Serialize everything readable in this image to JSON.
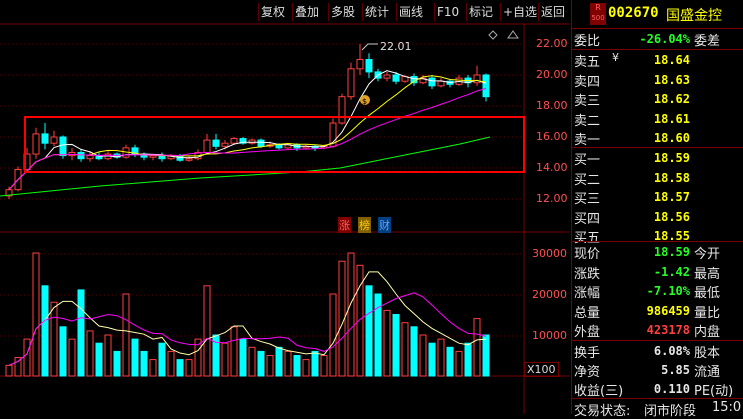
{
  "toolbar": {
    "buttons": [
      "复权",
      "叠加",
      "多股",
      "统计",
      "画线",
      "F10",
      "标记",
      "+自选",
      "返回"
    ]
  },
  "main_chart": {
    "y_ticks": [
      "22.01",
      "22.00",
      "20.00",
      "18.00",
      "16.00",
      "14.00",
      "12.00"
    ],
    "high_label": "22.01",
    "tags": [
      "涨",
      "榜",
      "财"
    ]
  },
  "volume_chart": {
    "y_ticks": [
      "30000",
      "20000",
      "10000"
    ],
    "unit": "X100"
  },
  "stock": {
    "r_badge": "R",
    "r_sub": "500",
    "code": "002670",
    "name": "国盛金控"
  },
  "weibi": {
    "label": "委比",
    "value": "-26.04%",
    "label2": "委差"
  },
  "asks": [
    {
      "label": "卖五",
      "mark": "¥",
      "price": "18.64"
    },
    {
      "label": "卖四",
      "mark": "",
      "price": "18.63"
    },
    {
      "label": "卖三",
      "mark": "",
      "price": "18.62"
    },
    {
      "label": "卖二",
      "mark": "",
      "price": "18.61"
    },
    {
      "label": "卖一",
      "mark": "",
      "price": "18.60"
    }
  ],
  "bids": [
    {
      "label": "买一",
      "price": "18.59"
    },
    {
      "label": "买二",
      "price": "18.58"
    },
    {
      "label": "买三",
      "price": "18.57"
    },
    {
      "label": "买四",
      "price": "18.56"
    },
    {
      "label": "买五",
      "price": "18.55"
    }
  ],
  "stats": [
    {
      "label": "现价",
      "value": "18.59",
      "label2": "今开",
      "color": "green"
    },
    {
      "label": "涨跌",
      "value": "-1.42",
      "label2": "最高",
      "color": "green"
    },
    {
      "label": "涨幅",
      "value": "-7.10%",
      "label2": "最低",
      "color": "green"
    },
    {
      "label": "总量",
      "value": "986459",
      "label2": "量比",
      "color": "yellow"
    },
    {
      "label": "外盘",
      "value": "423178",
      "label2": "内盘",
      "color": "red"
    }
  ],
  "stats2": [
    {
      "label": "换手",
      "value": "6.08%",
      "label2": "股本"
    },
    {
      "label": "净资",
      "value": "5.85",
      "label2": "流通"
    },
    {
      "label": "收益(三)",
      "value": "0.110",
      "label2": "PE(动)"
    }
  ],
  "status": {
    "label": "交易状态:",
    "value": "闭市阶段",
    "time": "15:0"
  },
  "colors": {
    "up": "#ff4040",
    "down": "#00ffff",
    "ma5": "#ffffff",
    "ma10": "#ffff00",
    "ma20": "#ff00ff",
    "ma60": "#00ff00",
    "grid": "#7a0000",
    "box": "#ff0000"
  }
}
